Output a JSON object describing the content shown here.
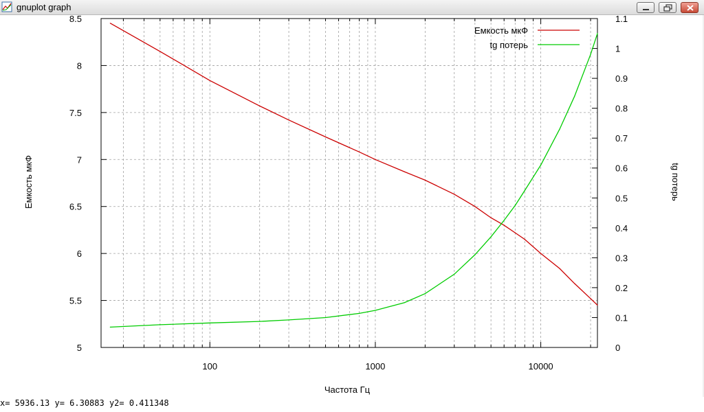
{
  "window": {
    "title": "gnuplot graph",
    "controls": {
      "minimize": "minimize",
      "maximize": "maximize",
      "close": "close"
    }
  },
  "status_text": "x= 5936.13 y= 6.30883 y2= 0.411348",
  "chart_data": {
    "type": "line",
    "title": "",
    "xlabel": "Частота Гц",
    "ylabel": "Емкость мкФ",
    "y2label": "tg потерь",
    "x_scale": "log",
    "xlim": [
      22,
      22000
    ],
    "ylim": [
      5,
      8.5
    ],
    "y2lim": [
      0,
      1.1
    ],
    "x_ticks": [
      100,
      1000,
      10000
    ],
    "x_tick_labels": [
      "100",
      "1000",
      "10000"
    ],
    "y_ticks": [
      5,
      5.5,
      6,
      6.5,
      7,
      7.5,
      8,
      8.5
    ],
    "y_tick_labels": [
      "5",
      "5.5",
      "6",
      "6.5",
      "7",
      "7.5",
      "8",
      "8.5"
    ],
    "y2_ticks": [
      0,
      0.1,
      0.2,
      0.3,
      0.4,
      0.5,
      0.6,
      0.7,
      0.8,
      0.9,
      1,
      1.1
    ],
    "y2_tick_labels": [
      "0",
      "0.1",
      "0.2",
      "0.3",
      "0.4",
      "0.5",
      "0.6",
      "0.7",
      "0.8",
      "0.9",
      "1",
      "1.1"
    ],
    "grid": true,
    "legend_position": "top-right",
    "series": [
      {
        "name": "Емкость мкФ",
        "color": "#cc0000",
        "axis": "y",
        "x": [
          25,
          50,
          100,
          200,
          300,
          500,
          800,
          1000,
          1500,
          2000,
          3000,
          4000,
          5000,
          6000,
          7000,
          8000,
          10000,
          13000,
          16000,
          20000,
          22000
        ],
        "y": [
          8.45,
          8.15,
          7.84,
          7.57,
          7.42,
          7.24,
          7.08,
          7.0,
          6.87,
          6.78,
          6.63,
          6.5,
          6.38,
          6.3,
          6.22,
          6.15,
          6.0,
          5.84,
          5.68,
          5.52,
          5.45
        ]
      },
      {
        "name": "tg потерь",
        "color": "#00cc00",
        "axis": "y2",
        "x": [
          25,
          50,
          100,
          200,
          300,
          500,
          800,
          1000,
          1500,
          2000,
          3000,
          4000,
          5000,
          6000,
          7000,
          8000,
          10000,
          13000,
          16000,
          20000,
          22000
        ],
        "y": [
          0.068,
          0.076,
          0.082,
          0.087,
          0.092,
          0.1,
          0.114,
          0.124,
          0.15,
          0.18,
          0.245,
          0.31,
          0.37,
          0.425,
          0.475,
          0.525,
          0.61,
          0.73,
          0.84,
          0.98,
          1.05
        ]
      }
    ]
  }
}
